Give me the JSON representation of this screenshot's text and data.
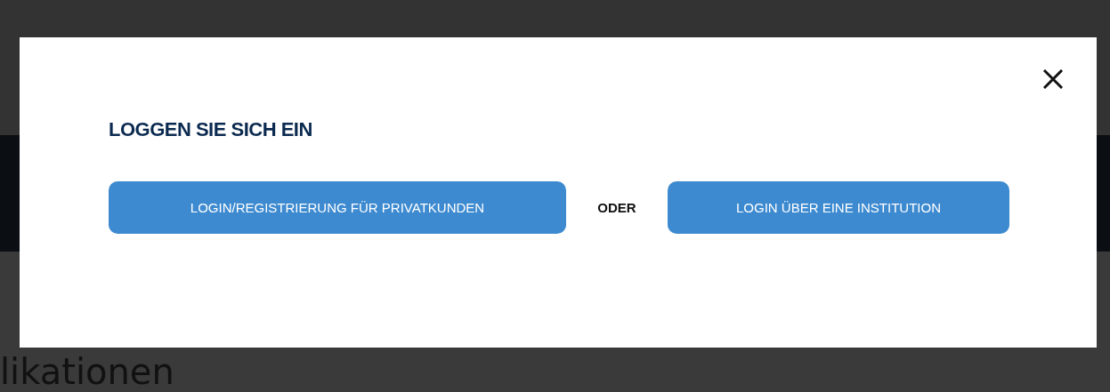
{
  "page": {
    "heading": "likationen"
  },
  "dialog": {
    "title": "LOGGEN SIE SICH EIN",
    "options": [
      {
        "label": "LOGIN/REGISTRIERUNG FÜR PRIVATKUNDEN",
        "kind": "wide"
      },
      {
        "label": "LOGIN ÜBER EINE INSTITUTION",
        "kind": "narrow"
      }
    ],
    "separator": "ODER"
  }
}
